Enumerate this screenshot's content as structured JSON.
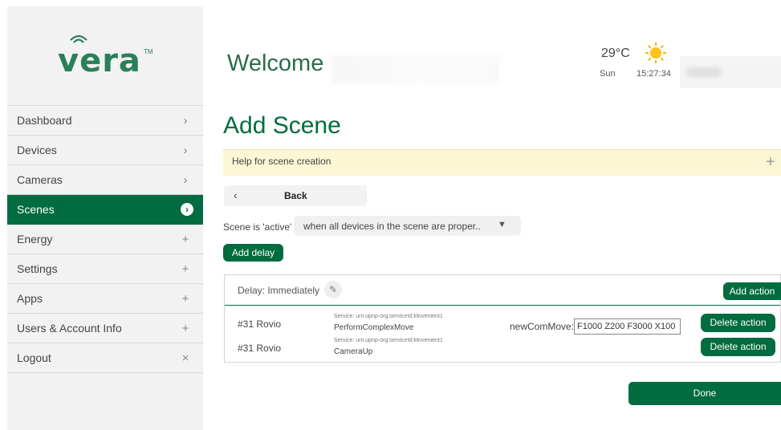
{
  "brand": {
    "logo_text": "vera",
    "trademark": "TM"
  },
  "sidebar": {
    "items": [
      {
        "label": "Dashboard",
        "icon": "›"
      },
      {
        "label": "Devices",
        "icon": "›"
      },
      {
        "label": "Cameras",
        "icon": "›"
      },
      {
        "label": "Scenes",
        "icon": "›",
        "active": true
      },
      {
        "label": "Energy",
        "icon": "+"
      },
      {
        "label": "Settings",
        "icon": "+"
      },
      {
        "label": "Apps",
        "icon": "+"
      },
      {
        "label": "Users & Account Info",
        "icon": "+"
      },
      {
        "label": "Logout",
        "icon": "×"
      }
    ]
  },
  "header": {
    "welcome": "Welcome",
    "temperature": "29°C",
    "day": "Sun",
    "time": "15:27:34"
  },
  "page": {
    "title": "Add Scene",
    "help_text": "Help for scene creation",
    "help_expand_icon": "+",
    "back_label": "Back",
    "active_label": "Scene is 'active'",
    "active_condition": "when all devices in the scene are proper..",
    "add_delay_label": "Add delay"
  },
  "actions_panel": {
    "delay_label": "Delay: Immediately",
    "add_action_label": "Add action",
    "rows": [
      {
        "device": "#31 Rovio",
        "service": "Service: urn:upnp-org:serviceId:Movement1",
        "action": "PerformComplexMove",
        "param_label": "newComMove:",
        "param_value": "F1000 Z200 F3000 X100",
        "delete_label": "Delete action"
      },
      {
        "device": "#31 Rovio",
        "service": "Service: urn:upnp-org:serviceId:Movement1",
        "action": "CameraUp",
        "delete_label": "Delete action"
      }
    ]
  },
  "footer": {
    "done_label": "Done"
  },
  "colors": {
    "brand_green": "#006c3f",
    "help_bg": "#fbf7d4",
    "sidebar_bg": "#f2f2f2"
  }
}
